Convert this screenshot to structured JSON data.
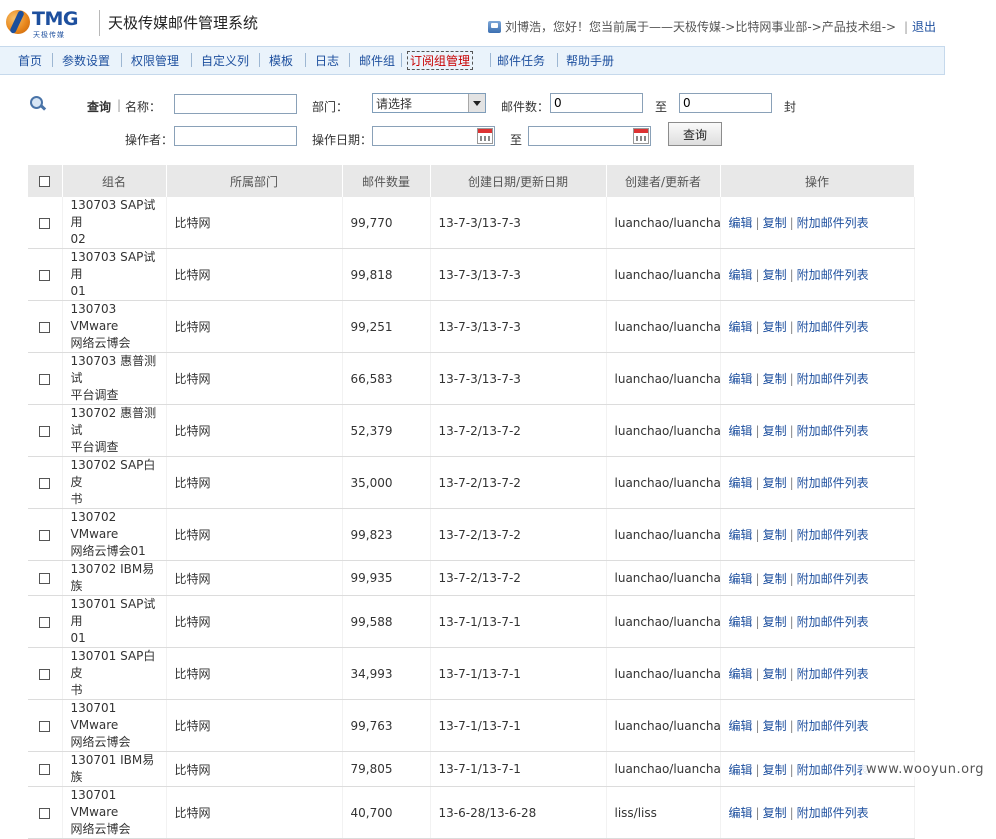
{
  "header": {
    "logo_text": "TMG",
    "logo_sub": "天极传媒",
    "system_title": "天极传媒邮件管理系统",
    "user_info": "刘博浩，您好！您当前属于——天极传媒->比特网事业部->产品技术组->",
    "logout": "退出"
  },
  "nav": {
    "items": [
      {
        "label": "首页"
      },
      {
        "label": "参数设置"
      },
      {
        "label": "权限管理"
      },
      {
        "label": "自定义列"
      },
      {
        "label": "模板"
      },
      {
        "label": "日志"
      },
      {
        "label": "邮件组"
      },
      {
        "label": "订阅组管理"
      },
      {
        "label": "邮件任务"
      },
      {
        "label": "帮助手册"
      }
    ]
  },
  "search": {
    "title": "查询",
    "name_label": "名称：",
    "name_value": "",
    "dept_label": "部门：",
    "dept_value": "请选择",
    "mail_count_label": "邮件数：",
    "mail_count_from": "0",
    "to": "至",
    "mail_count_to": "0",
    "unit": "封",
    "operator_label": "操作者：",
    "operator_value": "",
    "op_date_label": "操作日期：",
    "date_from": "",
    "date_to": "",
    "button": "查询"
  },
  "table": {
    "columns": [
      "组名",
      "所属部门",
      "邮件数量",
      "创建日期/更新日期",
      "创建者/更新者",
      "操作"
    ],
    "ops": [
      "编辑",
      "复制",
      "附加邮件列表"
    ],
    "rows": [
      {
        "name": [
          "130703 SAP试用",
          "02"
        ],
        "dept": "比特网",
        "count": "99,770",
        "date": "13-7-3/13-7-3",
        "user": "luanchao/luanchao"
      },
      {
        "name": [
          "130703 SAP试用",
          "01"
        ],
        "dept": "比特网",
        "count": "99,818",
        "date": "13-7-3/13-7-3",
        "user": "luanchao/luanchao"
      },
      {
        "name": [
          "130703 VMware",
          "网络云博会"
        ],
        "dept": "比特网",
        "count": "99,251",
        "date": "13-7-3/13-7-3",
        "user": "luanchao/luanchao"
      },
      {
        "name": [
          "130703 惠普测试",
          "平台调查"
        ],
        "dept": "比特网",
        "count": "66,583",
        "date": "13-7-3/13-7-3",
        "user": "luanchao/luanchao"
      },
      {
        "name": [
          "130702 惠普测试",
          "平台调查"
        ],
        "dept": "比特网",
        "count": "52,379",
        "date": "13-7-2/13-7-2",
        "user": "luanchao/luanchao"
      },
      {
        "name": [
          "130702 SAP白皮",
          "书"
        ],
        "dept": "比特网",
        "count": "35,000",
        "date": "13-7-2/13-7-2",
        "user": "luanchao/luanchao"
      },
      {
        "name": [
          "130702 VMware",
          "网络云博会01"
        ],
        "dept": "比特网",
        "count": "99,823",
        "date": "13-7-2/13-7-2",
        "user": "luanchao/luanchao"
      },
      {
        "name": [
          "130702 IBM易族"
        ],
        "dept": "比特网",
        "count": "99,935",
        "date": "13-7-2/13-7-2",
        "user": "luanchao/luanchao"
      },
      {
        "name": [
          "130701 SAP试用",
          "01"
        ],
        "dept": "比特网",
        "count": "99,588",
        "date": "13-7-1/13-7-1",
        "user": "luanchao/luanchao"
      },
      {
        "name": [
          "130701 SAP白皮",
          "书"
        ],
        "dept": "比特网",
        "count": "34,993",
        "date": "13-7-1/13-7-1",
        "user": "luanchao/luanchao"
      },
      {
        "name": [
          "130701 VMware",
          "网络云博会"
        ],
        "dept": "比特网",
        "count": "99,763",
        "date": "13-7-1/13-7-1",
        "user": "luanchao/luanchao"
      },
      {
        "name": [
          "130701 IBM易族"
        ],
        "dept": "比特网",
        "count": "79,805",
        "date": "13-7-1/13-7-1",
        "user": "luanchao/luanchao"
      },
      {
        "name": [
          "130701 VMware",
          "网络云博会"
        ],
        "dept": "比特网",
        "count": "40,700",
        "date": "13-6-28/13-6-28",
        "user": "liss/liss"
      }
    ]
  },
  "watermark": "www.wooyun.org"
}
